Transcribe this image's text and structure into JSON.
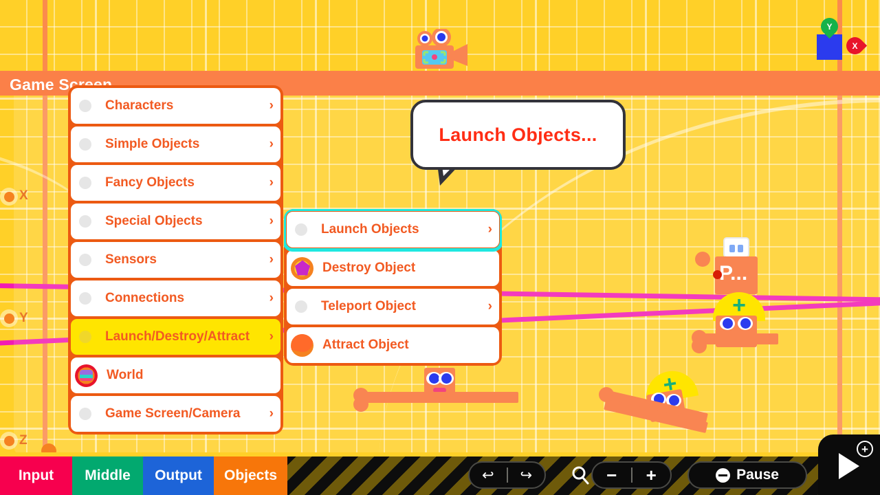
{
  "app": {
    "game_screen_label": "Game Screen"
  },
  "axes": [
    {
      "label": "X"
    },
    {
      "label": "Y"
    },
    {
      "label": "Z"
    }
  ],
  "object_markers": {
    "y_pin": "Y",
    "x_pin": "X"
  },
  "nodon_label": "P...",
  "tooltip": {
    "text": "Launch Objects..."
  },
  "main_menu": {
    "items": [
      {
        "label": "Characters",
        "icon": "bullet",
        "chevron": "›",
        "state": "normal"
      },
      {
        "label": "Simple Objects",
        "icon": "bullet",
        "chevron": "›",
        "state": "normal"
      },
      {
        "label": "Fancy Objects",
        "icon": "bullet",
        "chevron": "›",
        "state": "normal"
      },
      {
        "label": "Special Objects",
        "icon": "bullet",
        "chevron": "›",
        "state": "normal"
      },
      {
        "label": "Sensors",
        "icon": "bullet",
        "chevron": "›",
        "state": "normal"
      },
      {
        "label": "Connections",
        "icon": "bullet",
        "chevron": "›",
        "state": "normal"
      },
      {
        "label": "Launch/Destroy/Attract",
        "icon": "bullet",
        "chevron": "›",
        "state": "highlight"
      },
      {
        "label": "World",
        "icon": "world-icon",
        "chevron": "",
        "state": "normal"
      },
      {
        "label": "Game Screen/Camera",
        "icon": "bullet",
        "chevron": "›",
        "state": "normal"
      }
    ]
  },
  "sub_menu": {
    "items": [
      {
        "label": "Launch Objects",
        "icon": "bullet",
        "chevron": "›",
        "state": "selected"
      },
      {
        "label": "Destroy Object",
        "icon": "destroy-icon",
        "chevron": "",
        "state": "normal"
      },
      {
        "label": "Teleport Object",
        "icon": "bullet",
        "chevron": "›",
        "state": "normal"
      },
      {
        "label": "Attract Object",
        "icon": "attract-icon",
        "chevron": "",
        "state": "normal"
      }
    ]
  },
  "tabs": [
    {
      "label": "Input",
      "color": "#F7004E"
    },
    {
      "label": "Middle",
      "color": "#02A96F"
    },
    {
      "label": "Output",
      "color": "#1D64D8"
    },
    {
      "label": "Objects",
      "color": "#F7760A"
    }
  ],
  "controls": {
    "undo": "↩",
    "redo": "↪",
    "search": "search-icon",
    "zoom_out": "−",
    "zoom_in": "+",
    "pause_label": "Pause",
    "play": "play-icon",
    "plus": "+"
  },
  "colors": {
    "background": "#FFD028",
    "menu_frame": "#EC5A12",
    "menu_text": "#F25A22",
    "highlight": "#FFE500",
    "selection_outline": "#1EE8E0",
    "tooltip_text": "#FF2D14",
    "wire": "#F21BB4",
    "nodon_body": "#F98552"
  }
}
